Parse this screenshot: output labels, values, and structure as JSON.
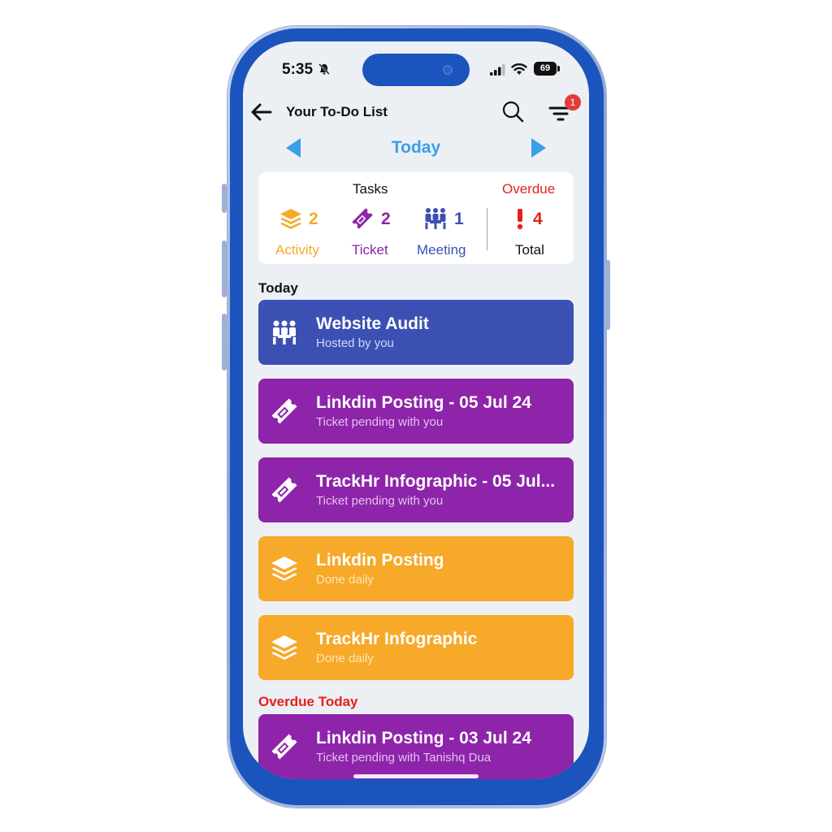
{
  "status_bar": {
    "time": "5:35",
    "battery": "69"
  },
  "header": {
    "title": "Your To-Do List",
    "filter_badge": "1"
  },
  "day_nav": {
    "label": "Today"
  },
  "summary": {
    "tasks_heading": "Tasks",
    "overdue_heading": "Overdue",
    "activity": {
      "count": "2",
      "label": "Activity"
    },
    "ticket": {
      "count": "2",
      "label": "Ticket"
    },
    "meeting": {
      "count": "1",
      "label": "Meeting"
    },
    "overdue": {
      "count": "4",
      "label": "Total"
    }
  },
  "sections": {
    "today": {
      "title": "Today"
    },
    "overdue_today": {
      "title": "Overdue Today"
    }
  },
  "tasks": [
    {
      "type": "meeting",
      "title": "Website Audit",
      "subtitle": "Hosted by you"
    },
    {
      "type": "ticket",
      "title": "Linkdin Posting - 05 Jul 24",
      "subtitle": "Ticket pending with you"
    },
    {
      "type": "ticket",
      "title": "TrackHr Infographic - 05 Jul...",
      "subtitle": "Ticket pending with you"
    },
    {
      "type": "activity",
      "title": "Linkdin Posting",
      "subtitle": "Done daily"
    },
    {
      "type": "activity",
      "title": "TrackHr Infographic",
      "subtitle": "Done daily"
    }
  ],
  "overdue_tasks": [
    {
      "type": "ticket",
      "title": "Linkdin Posting - 03 Jul 24",
      "subtitle": "Ticket pending with Tanishq Dua"
    }
  ],
  "colors": {
    "meeting": "#3c50b4",
    "ticket": "#8e24aa",
    "activity": "#f7a929",
    "today_blue": "#3aa0e8",
    "overdue_red": "#e5201c",
    "phone_frame": "#1b54bd"
  }
}
